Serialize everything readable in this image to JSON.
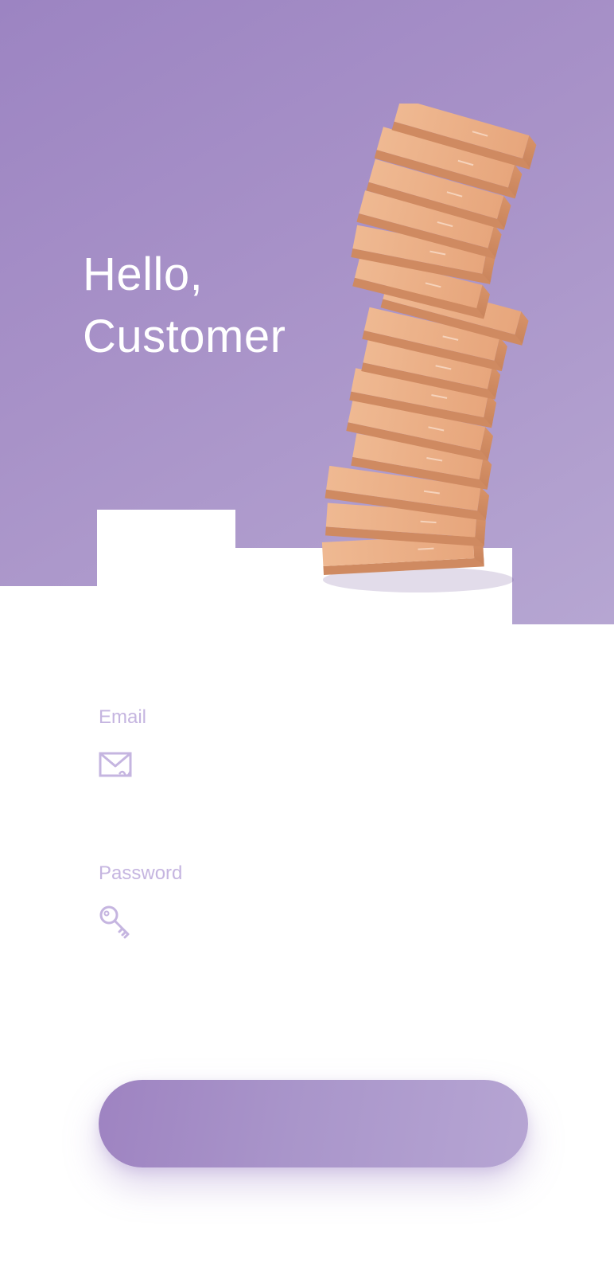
{
  "hero": {
    "greeting_line1": "Hello,",
    "greeting_line2": "Customer",
    "image_alt": "stack-of-cardboard-boxes"
  },
  "form": {
    "email": {
      "label": "Email",
      "icon": "envelope-icon",
      "value": "",
      "placeholder": ""
    },
    "password": {
      "label": "Password",
      "icon": "key-icon",
      "value": "",
      "placeholder": ""
    }
  },
  "submit": {
    "label": ""
  },
  "colors": {
    "accent": "#a08bc6",
    "accent_light": "#b6a6d2",
    "label": "#c5b5e0",
    "box": "#e8a97e"
  }
}
